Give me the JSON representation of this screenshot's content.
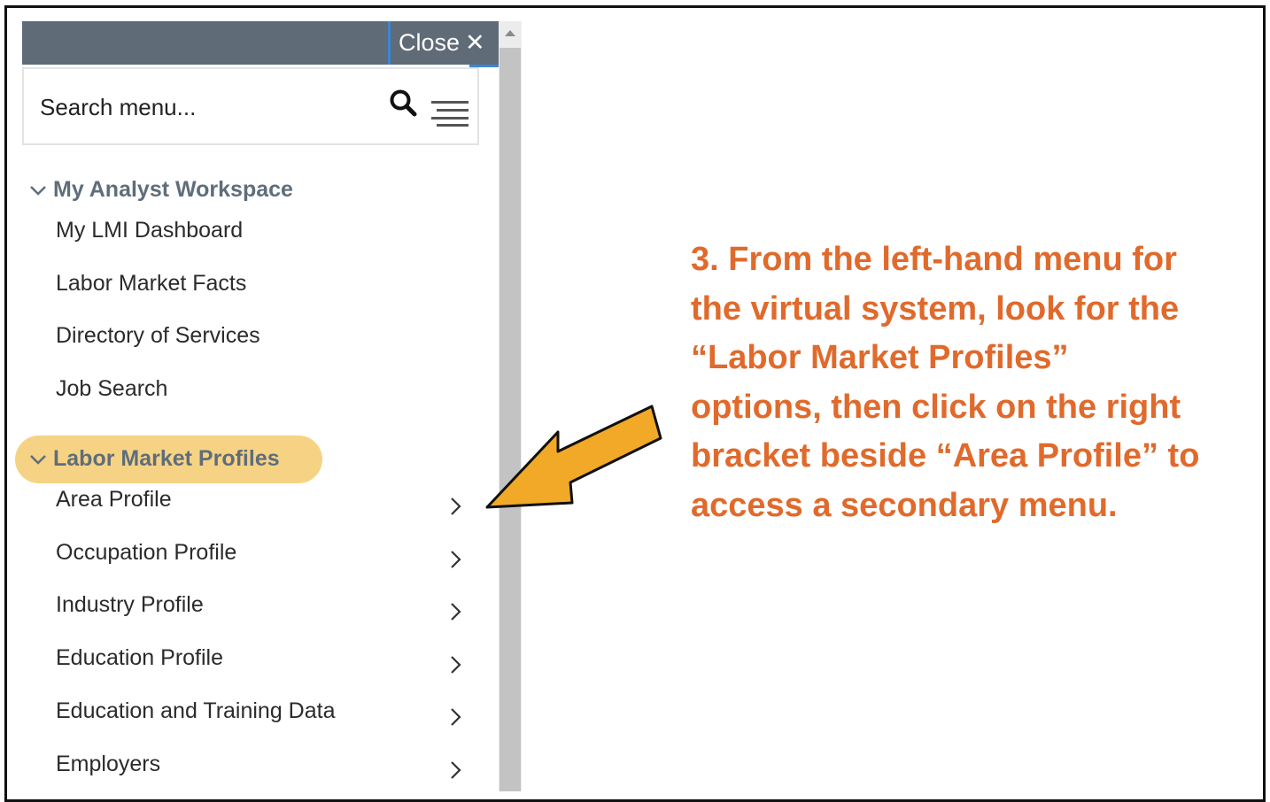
{
  "menu": {
    "close_label": "Close",
    "close_icon": "✕",
    "search_placeholder": "Search menu...",
    "sections": [
      {
        "title": "My Analyst Workspace",
        "items": [
          "My LMI Dashboard",
          "Labor Market Facts",
          "Directory of Services",
          "Job Search"
        ]
      },
      {
        "title": "Labor Market Profiles",
        "items": [
          "Area Profile",
          "Occupation Profile",
          "Industry Profile",
          "Education Profile",
          "Education and Training Data",
          "Employers"
        ]
      }
    ]
  },
  "instruction": {
    "lines": [
      "3. From the left-hand menu for",
      "the virtual system, look for the",
      "“Labor Market Profiles”",
      "options, then click on the right",
      "bracket beside “Area Profile” to",
      "access a secondary menu."
    ]
  },
  "colors": {
    "topbar": "#5f6b77",
    "section_header": "#5f6d7b",
    "highlight": "#f6d384",
    "arrow": "#f2a928",
    "instruction_text": "#e06a2c",
    "accent": "#3b86d6"
  }
}
